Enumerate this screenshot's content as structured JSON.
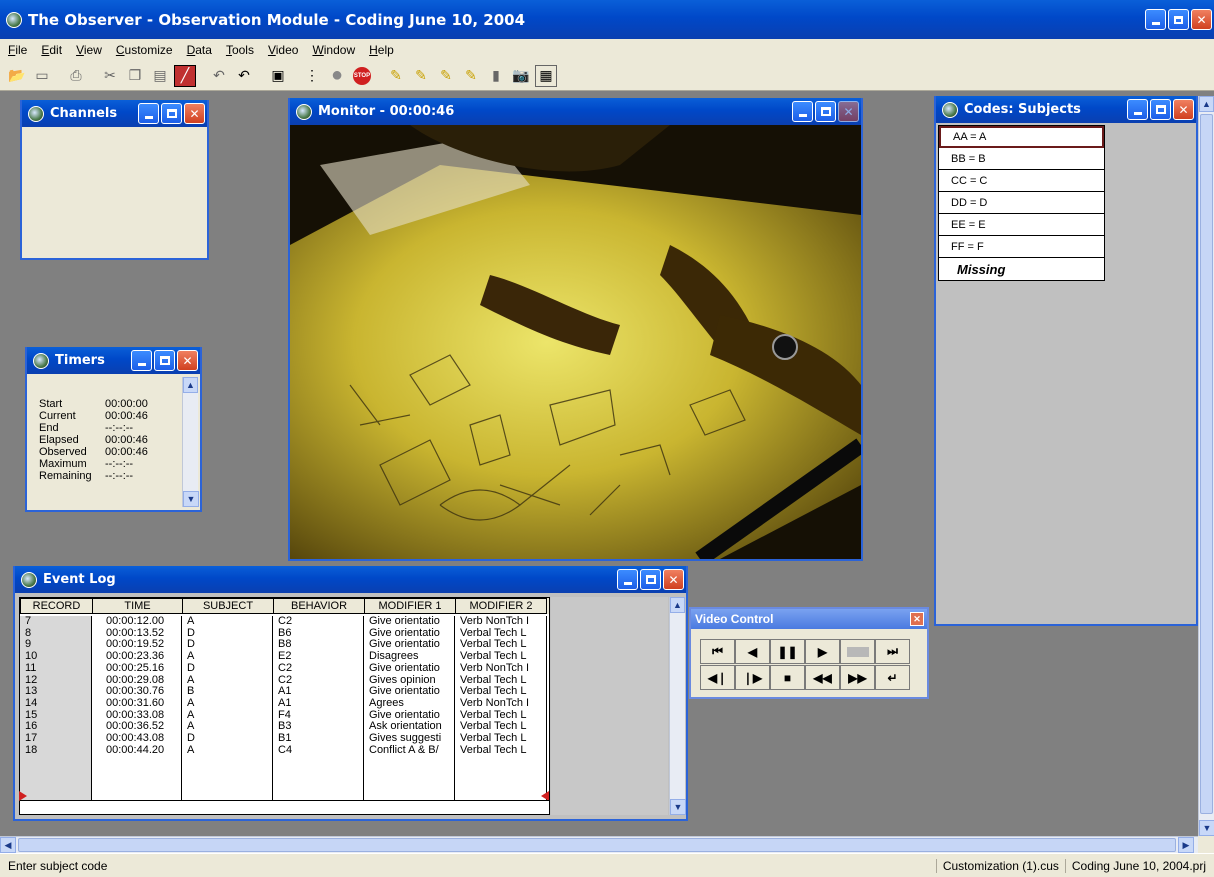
{
  "app": {
    "title": "The Observer - Observation Module - Coding June 10, 2004"
  },
  "menu": [
    "File",
    "Edit",
    "View",
    "Customize",
    "Data",
    "Tools",
    "Video",
    "Window",
    "Help"
  ],
  "toolbar": [
    "open-icon",
    "save-icon",
    "print-icon",
    "cut-icon",
    "copy-icon",
    "paste-icon",
    "edit-icon",
    "undo-icon",
    "redo-icon",
    "window-icon",
    "list-icon",
    "record-icon",
    "stop-icon",
    "marker-1-icon",
    "marker-2-icon",
    "marker-3-icon",
    "marker-4-icon",
    "marker-5-icon",
    "camera-icon",
    "grid-icon"
  ],
  "channels": {
    "title": "Channels"
  },
  "timers": {
    "title": "Timers",
    "rows": [
      {
        "label": "Start",
        "value": "00:00:00"
      },
      {
        "label": "Current",
        "value": "00:00:46"
      },
      {
        "label": "End",
        "value": "--:--:--"
      },
      {
        "label": "Elapsed",
        "value": "00:00:46"
      },
      {
        "label": "Observed",
        "value": "00:00:46"
      },
      {
        "label": "Maximum",
        "value": "--:--:--"
      },
      {
        "label": "Remaining",
        "value": "--:--:--"
      }
    ]
  },
  "monitor": {
    "title": "Monitor - 00:00:46"
  },
  "codes": {
    "title": "Codes: Subjects",
    "items": [
      "AA = A",
      "BB = B",
      "CC = C",
      "DD = D",
      "EE = E",
      "FF = F"
    ],
    "missing": "Missing"
  },
  "event_log": {
    "title": "Event Log",
    "headers": [
      "RECORD",
      "TIME",
      "SUBJECT",
      "BEHAVIOR",
      "MODIFIER 1",
      "MODIFIER 2"
    ],
    "rows": [
      [
        "7",
        "00:00:12.00",
        "A",
        "C2",
        "Give orientatio",
        "Verb NonTch I"
      ],
      [
        "8",
        "00:00:13.52",
        "D",
        "B6",
        "Give orientatio",
        "Verbal Tech L"
      ],
      [
        "9",
        "00:00:19.52",
        "D",
        "B8",
        "Give orientatio",
        "Verbal Tech L"
      ],
      [
        "10",
        "00:00:23.36",
        "A",
        "E2",
        "Disagrees",
        "Verbal Tech L"
      ],
      [
        "11",
        "00:00:25.16",
        "D",
        "C2",
        "Give orientatio",
        "Verb NonTch I"
      ],
      [
        "12",
        "00:00:29.08",
        "A",
        "C2",
        "Gives opinion",
        "Verbal Tech L"
      ],
      [
        "13",
        "00:00:30.76",
        "B",
        "A1",
        "Give orientatio",
        "Verbal Tech L"
      ],
      [
        "14",
        "00:00:31.60",
        "A",
        "A1",
        "Agrees",
        "Verb NonTch I"
      ],
      [
        "15",
        "00:00:33.08",
        "A",
        "F4",
        "Give orientatio",
        "Verbal Tech L"
      ],
      [
        "16",
        "00:00:36.52",
        "A",
        "B3",
        "Ask orientation",
        "Verbal Tech L"
      ],
      [
        "17",
        "00:00:43.08",
        "D",
        "B1",
        "Gives suggesti",
        "Verbal Tech L"
      ],
      [
        "18",
        "00:00:44.20",
        "A",
        "C4",
        "Conflict A & B/",
        "Verbal Tech L"
      ]
    ]
  },
  "video_control": {
    "title": "Video Control",
    "row1": [
      "⏮",
      "◀",
      "❚❚",
      "▶",
      "",
      "⏭"
    ],
    "row2": [
      "◀❘",
      "❘▶",
      "■",
      "◀◀",
      "▶▶",
      "↵"
    ]
  },
  "status": {
    "left": "Enter subject code",
    "cus": "Customization (1).cus",
    "prj": "Coding June 10, 2004.prj"
  }
}
